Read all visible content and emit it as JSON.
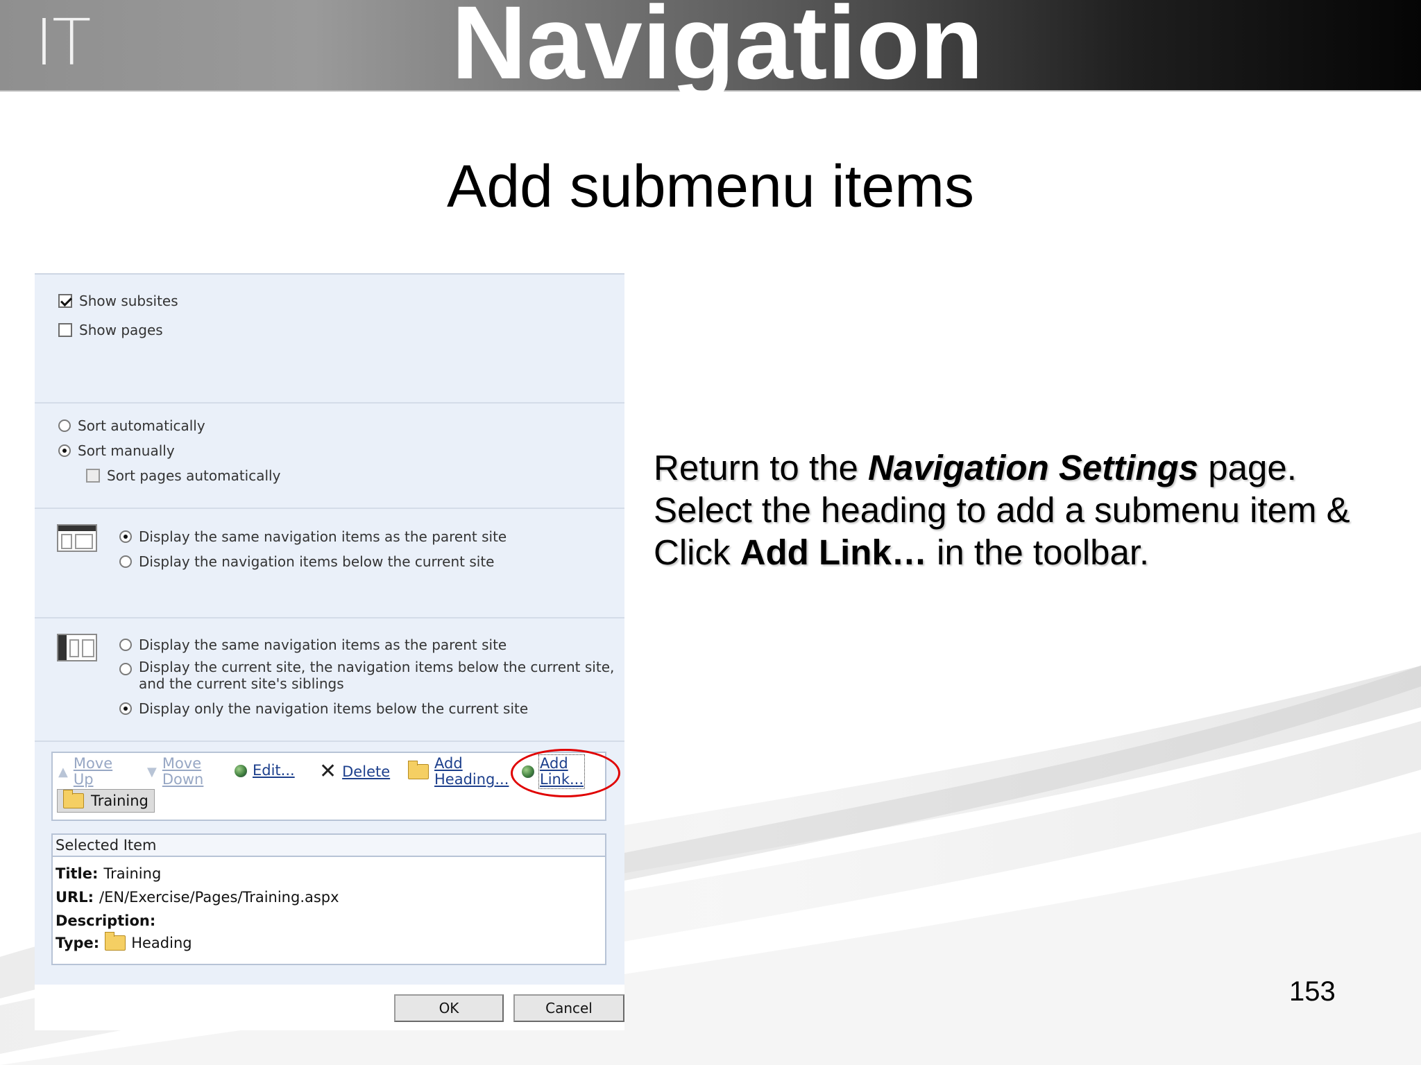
{
  "header": {
    "logo": "IT",
    "title": "Navigation"
  },
  "slide": {
    "title": "Add submenu items",
    "page_number": "153",
    "instructions": {
      "line1_pre": "Return to the ",
      "line1_em": "Navigation Settings",
      "line1_post": " page.",
      "line2": "Select the heading to add a submenu item &",
      "line3_pre": "Click ",
      "line3_em": "Add Link…",
      "line3_post": " in the toolbar."
    }
  },
  "colors": {
    "highlight_ring": "#e00000",
    "link": "#1c3f8c",
    "panel_bg": "#eaf0f9"
  },
  "screenshot": {
    "show_subsites": {
      "label": "Show subsites",
      "checked": true
    },
    "show_pages": {
      "label": "Show pages",
      "checked": false
    },
    "sort_automatically": "Sort automatically",
    "sort_manually": "Sort manually",
    "sort_pages_automatically": "Sort pages automatically",
    "global_nav": {
      "opt1": "Display the same navigation items as the parent site",
      "opt2": "Display the navigation items below the current site"
    },
    "current_nav": {
      "opt1": "Display the same navigation items as the parent site",
      "opt2_line1": "Display the current site, the navigation items below the current site,",
      "opt2_line2": "and the current site's siblings",
      "opt3": "Display only the navigation items below the current site"
    },
    "toolbar": {
      "move_up": [
        "Move",
        "Up"
      ],
      "move_down": [
        "Move",
        "Down"
      ],
      "edit": "Edit...",
      "delete": "Delete",
      "add_heading": [
        "Add",
        "Heading..."
      ],
      "add_link": [
        "Add",
        "Link..."
      ]
    },
    "tree_item": "Training",
    "selected_item": {
      "header": "Selected Item",
      "title_label": "Title:",
      "title_value": "Training",
      "url_label": "URL:",
      "url_value": "/EN/Exercise/Pages/Training.aspx",
      "desc_label": "Description:",
      "type_label": "Type:",
      "type_value": "Heading"
    },
    "buttons": {
      "ok": "OK",
      "cancel": "Cancel"
    }
  }
}
